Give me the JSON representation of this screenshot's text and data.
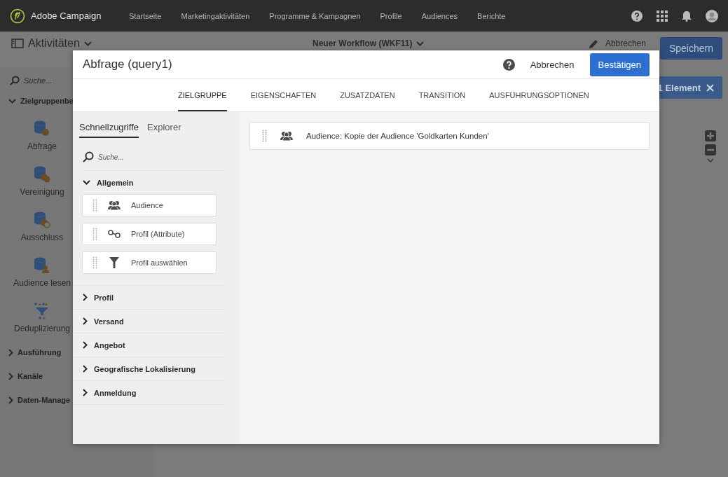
{
  "app_bar": {
    "brand": "Adobe Campaign",
    "nav": [
      {
        "label": "Startseite"
      },
      {
        "label": "Marketingaktivitäten"
      },
      {
        "label": "Programme & Kampagnen"
      },
      {
        "label": "Profile"
      },
      {
        "label": "Audiences"
      },
      {
        "label": "Berichte"
      }
    ]
  },
  "workspace": {
    "activities_title": "Aktivitäten",
    "workflow_title": "Neuer Workflow (WKF11)",
    "cancel": "Abbrechen",
    "save": "Speichern",
    "search_placeholder": "Suche...",
    "selection": "1 Element",
    "sections": [
      {
        "label": "Zielgruppenbe",
        "expanded": true,
        "items": [
          {
            "label": "Abfrage",
            "kind": "query"
          },
          {
            "label": "Vereinigung",
            "kind": "union"
          },
          {
            "label": "Ausschluss",
            "kind": "exclusion"
          },
          {
            "label": "Audience lesen",
            "kind": "read"
          },
          {
            "label": "Deduplizierung",
            "kind": "dedup"
          }
        ]
      },
      {
        "label": "Ausführung",
        "expanded": false
      },
      {
        "label": "Kanäle",
        "expanded": false
      },
      {
        "label": "Daten-Manage",
        "expanded": false
      }
    ]
  },
  "dialog": {
    "title": "Abfrage (query1)",
    "cancel": "Abbrechen",
    "confirm": "Bestätigen",
    "tabs": [
      {
        "label": "ZIELGRUPPE",
        "selected": true
      },
      {
        "label": "EIGENSCHAFTEN",
        "selected": false
      },
      {
        "label": "ZUSATZDATEN",
        "selected": false
      },
      {
        "label": "TRANSITION",
        "selected": false
      },
      {
        "label": "AUSFÜHRUNGSOPTIONEN",
        "selected": false
      }
    ],
    "side_tabs": [
      {
        "label": "Schnellzugriffe",
        "selected": true
      },
      {
        "label": "Explorer",
        "selected": false
      }
    ],
    "search_placeholder": "Suche...",
    "groups": [
      {
        "label": "Allgemein",
        "expanded": true,
        "items": [
          {
            "label": "Audience",
            "kind": "audience"
          },
          {
            "label": "Profil (Attribute)",
            "kind": "link"
          },
          {
            "label": "Profil auswählen",
            "kind": "filter"
          }
        ]
      },
      {
        "label": "Profil",
        "expanded": false
      },
      {
        "label": "Versand",
        "expanded": false
      },
      {
        "label": "Angebot",
        "expanded": false
      },
      {
        "label": "Geografische Lokalisierung",
        "expanded": false
      },
      {
        "label": "Anmeldung",
        "expanded": false
      }
    ],
    "conditions": [
      {
        "label": "Audience: Kopie der Audience 'Goldkarten Kunden'",
        "kind": "audience"
      }
    ]
  }
}
